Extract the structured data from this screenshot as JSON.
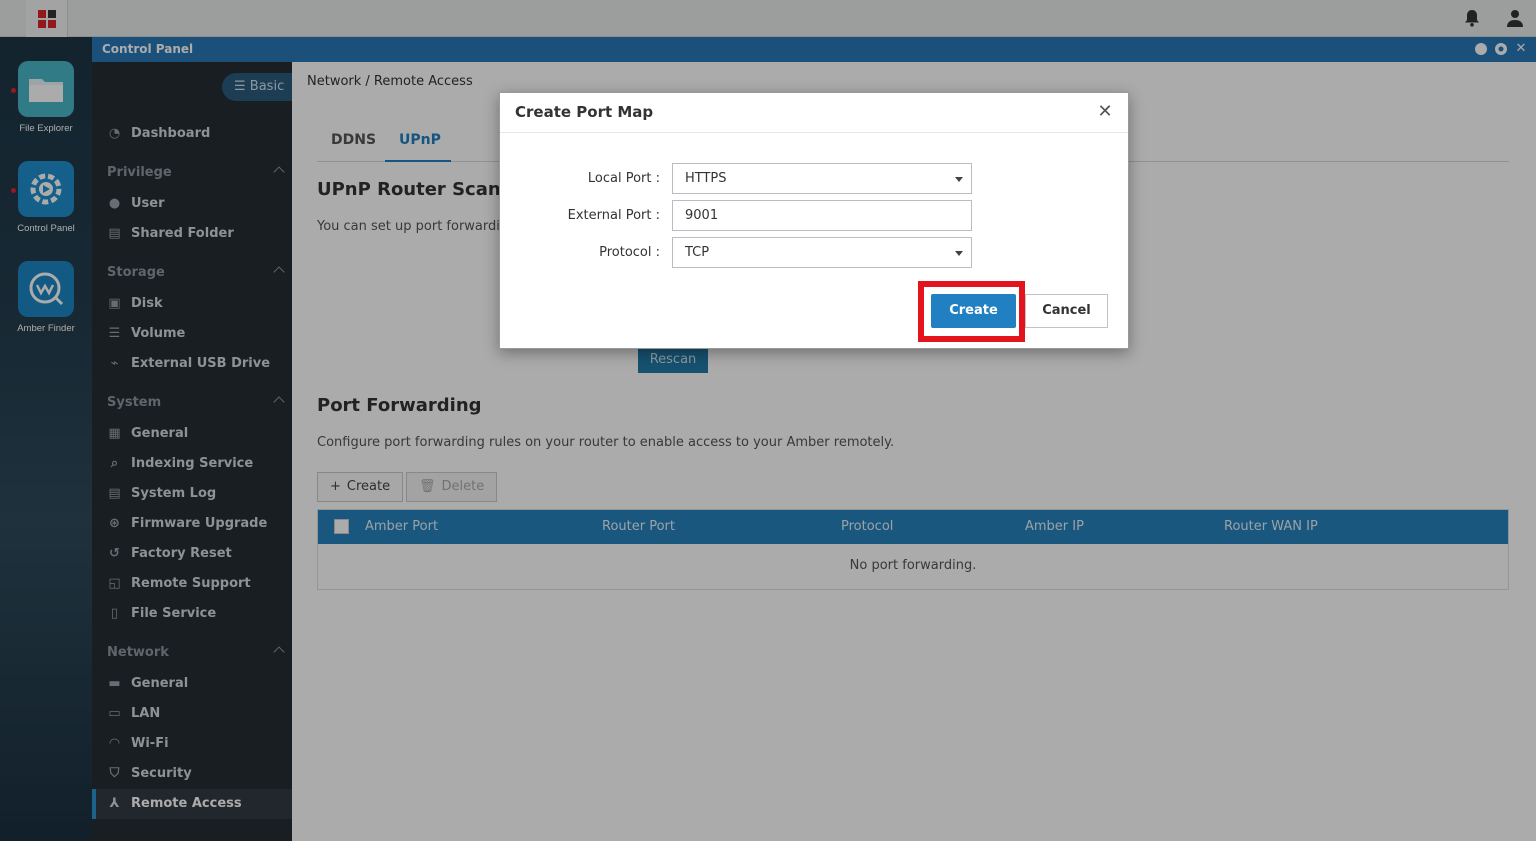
{
  "window": {
    "title": "Control Panel"
  },
  "dock": [
    {
      "label": "File Explorer"
    },
    {
      "label": "Control Panel"
    },
    {
      "label": "Amber Finder"
    }
  ],
  "sidebar": {
    "basic_label": "Basic",
    "dashboard": "Dashboard",
    "groups": {
      "privilege": "Privilege",
      "storage": "Storage",
      "system": "System",
      "network": "Network"
    },
    "items": {
      "user": "User",
      "shared_folder": "Shared Folder",
      "disk": "Disk",
      "volume": "Volume",
      "external_usb": "External USB Drive",
      "general": "General",
      "indexing": "Indexing Service",
      "system_log": "System Log",
      "firmware": "Firmware Upgrade",
      "factory_reset": "Factory Reset",
      "remote_support": "Remote Support",
      "file_service": "File Service",
      "net_general": "General",
      "lan": "LAN",
      "wifi": "Wi-Fi",
      "security": "Security",
      "remote_access": "Remote Access"
    }
  },
  "content": {
    "breadcrumb": "Network / Remote Access",
    "tabs": [
      "DDNS",
      "UPnP"
    ],
    "upnp_title": "UPnP Router Scan",
    "upnp_desc": "You can set up port forwarding",
    "rescan_label": "Rescan",
    "pf_title": "Port Forwarding",
    "pf_desc": "Configure port forwarding rules on your router to enable access to your Amber remotely.",
    "create_label": "Create",
    "delete_label": "Delete",
    "columns": [
      "Amber Port",
      "Router Port",
      "Protocol",
      "Amber IP",
      "Router WAN IP"
    ],
    "empty": "No port forwarding."
  },
  "dialog": {
    "title": "Create Port Map",
    "local_port_label": "Local Port :",
    "local_port_value": "HTTPS",
    "external_port_label": "External Port :",
    "external_port_value": "9001",
    "protocol_label": "Protocol :",
    "protocol_value": "TCP",
    "create_button": "Create",
    "cancel_button": "Cancel"
  }
}
